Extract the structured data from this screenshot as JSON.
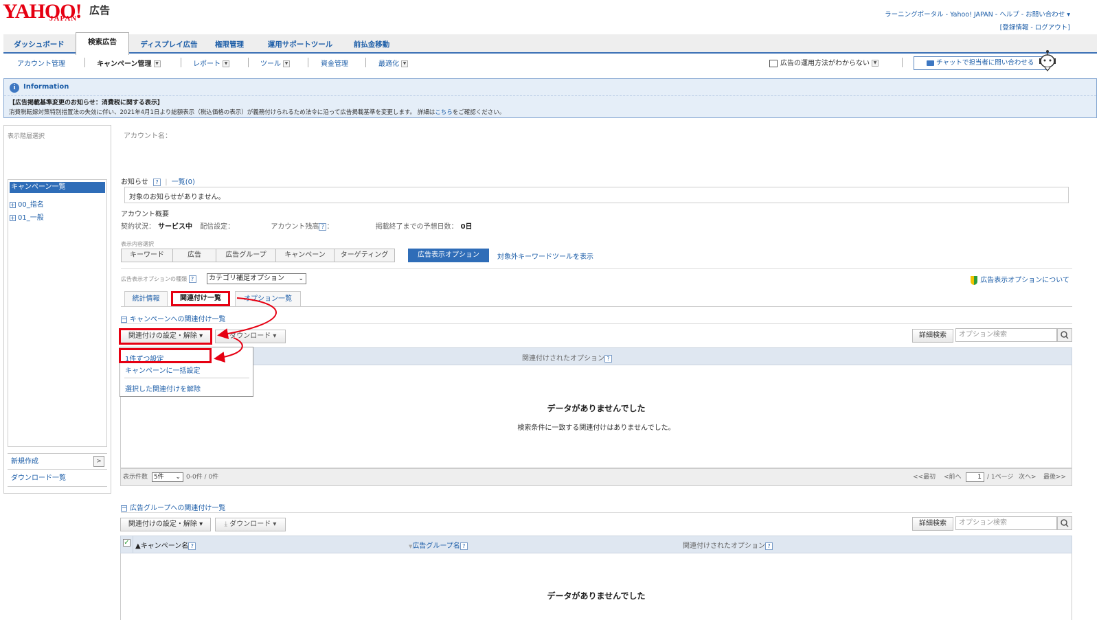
{
  "header": {
    "logo": "YAHOO!",
    "logo_sub": "JAPAN",
    "logo_ad": "広告",
    "top_links_1": "ラーニングポータル - Yahoo! JAPAN - ヘルプ - お問い合わせ ▾",
    "top_links_2": "[登録情報 - ログアウト]"
  },
  "main_tabs": [
    "ダッシュボード",
    "検索広告",
    "ディスプレイ広告",
    "権限管理",
    "運用サポートツール",
    "前払金移動"
  ],
  "sub_nav": {
    "account": "アカウント管理",
    "campaign": "キャンペーン管理",
    "report": "レポート",
    "tools": "ツール",
    "funds": "資金管理",
    "optimize": "最適化",
    "help_question": "広告の運用方法がわからない",
    "chat_button": "チャットで担当者に問い合わせる"
  },
  "info": {
    "title": "Information",
    "heading": "【広告掲載基準変更のお知らせ：消費税に関する表示】",
    "body": "消費税転嫁対策特別措置法の失効に伴い、2021年4月1日より総額表示（税込価格の表示）が義務付けられるため法令に沿って広告掲載基準を変更します。 詳細は",
    "link": "こちら",
    "body_end": "をご確認ください。"
  },
  "sidebar": {
    "label": "表示階層選択",
    "selected": "キャンペーン一覧",
    "tree": [
      "00_指名",
      "01_一般"
    ],
    "new_create": "新規作成",
    "download_list": "ダウンロード一覧"
  },
  "main": {
    "account_name_label": "アカウント名：",
    "notice_label": "お知らせ",
    "notice_list": "一覧(0)",
    "notice_empty": "対象のお知らせがありません。",
    "overview_label": "アカウント概要",
    "contract_label": "契約状況：",
    "contract_value": "サービス中",
    "delivery_label": "配信設定：",
    "balance_label": "アカウント残高",
    "balance_colon": "：",
    "days_label": "掲載終了までの予想日数：",
    "days_value": "0日",
    "view_select_label": "表示内容選択",
    "view_tabs": [
      "キーワード",
      "広告",
      "広告グループ",
      "キャンペーン",
      "ターゲティング"
    ],
    "view_tab_active": "広告表示オプション",
    "view_link": "対象外キーワードツールを表示",
    "option_type_label": "広告表示オプションの種類",
    "option_type_value": "カテゴリ補足オプション",
    "about_options": "広告表示オプションについて",
    "sub_tabs": [
      "統計情報",
      "関連付け一覧",
      "オプション一覧"
    ]
  },
  "section1": {
    "title": "キャンペーンへの関連付け一覧",
    "assoc_button": "関連付けの設定・解除 ▾",
    "download_button": "ダウンロード ▾",
    "detail_search": "詳細検索",
    "search_placeholder": "オプション検索",
    "col_options": "関連付けされたオプション",
    "menu": [
      "1件ずつ設定",
      "キャンペーンに一括設定",
      "選択した関連付けを解除"
    ],
    "nodata_title": "データがありませんでした",
    "nodata_body": "検索条件に一致する関連付けはありませんでした。",
    "count_label": "表示件数",
    "count_value": "5件",
    "range": "0-0件 / 0件",
    "pager_first": "<<最初",
    "pager_prev": "<前へ",
    "pager_page": "1",
    "pager_total": "/ 1ページ",
    "pager_next": "次へ>",
    "pager_last": "最後>>"
  },
  "section2": {
    "title": "広告グループへの関連付け一覧",
    "assoc_button": "関連付けの設定・解除 ▾",
    "download_button": "ダウンロード ▾",
    "detail_search": "詳細検索",
    "search_placeholder": "オプション検索",
    "col_campaign": "▲キャンペーン名",
    "col_adgroup": "広告グループ名",
    "col_options": "関連付けされたオプション",
    "nodata_title": "データがありませんでした"
  },
  "colors": {
    "accent": "#2f6db8",
    "highlight": "#e60012",
    "brand": "#e60012"
  }
}
